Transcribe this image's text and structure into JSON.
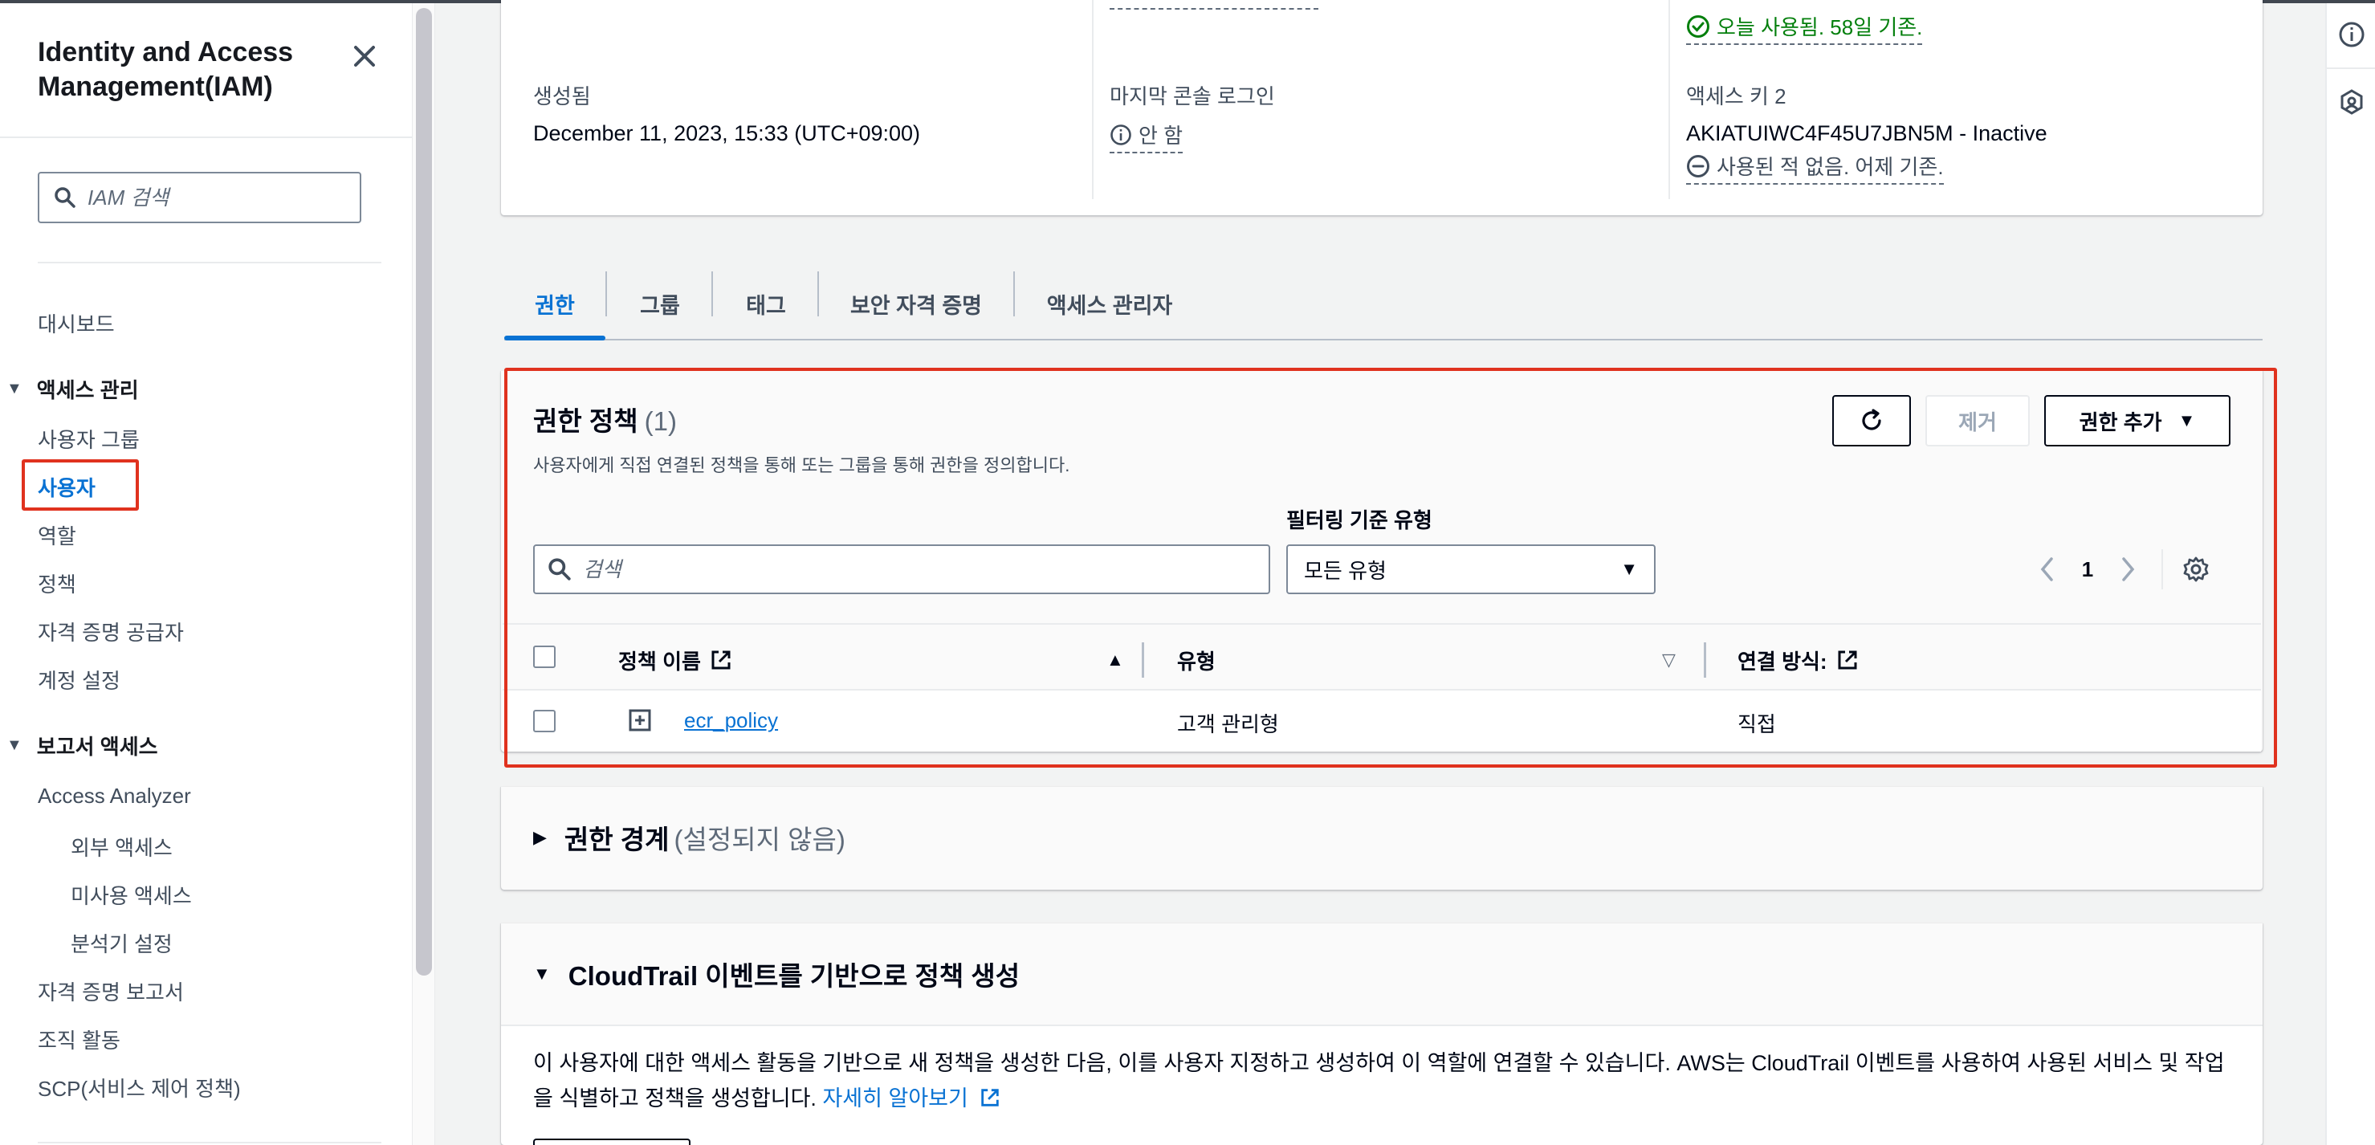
{
  "sidebar": {
    "title": "Identity and Access Management(IAM)",
    "search_placeholder": "IAM 검색",
    "dashboard": "대시보드",
    "access_mgmt": {
      "label": "액세스 관리",
      "items": [
        "사용자 그룹",
        "사용자",
        "역할",
        "정책",
        "자격 증명 공급자",
        "계정 설정"
      ],
      "active_item": "사용자"
    },
    "reports": {
      "label": "보고서 액세스",
      "analyzer": "Access Analyzer",
      "analyzer_sub": [
        "외부 액세스",
        "미사용 액세스",
        "분석기 설정"
      ],
      "items": [
        "자격 증명 보고서",
        "조직 활동",
        "SCP(서비스 제어 정책)"
      ]
    }
  },
  "summary": {
    "created_label": "생성됨",
    "created_value": "December 11, 2023, 15:33 (UTC+09:00)",
    "last_login_label": "마지막 콘솔 로그인",
    "last_login_value": "안 함",
    "key1_status": "오늘 사용됨. 58일 기존.",
    "key2_label": "액세스 키 2",
    "key2_value": "AKIATUIWC4F45U7JBN5M - Inactive",
    "key2_status": "사용된 적 없음. 어제 기존."
  },
  "tabs": [
    "권한",
    "그룹",
    "태그",
    "보안 자격 증명",
    "액세스 관리자"
  ],
  "permissions": {
    "title": "권한 정책",
    "count": "(1)",
    "description": "사용자에게 직접 연결된 정책을 통해 또는 그룹을 통해 권한을 정의합니다.",
    "remove_label": "제거",
    "add_label": "권한 추가",
    "filter_label": "필터링 기준 유형",
    "search_placeholder": "검색",
    "filter_value": "모든 유형",
    "page": "1",
    "columns": [
      "정책 이름",
      "유형",
      "연결 방식:"
    ],
    "rows": [
      {
        "name": "ecr_policy",
        "type": "고객 관리형",
        "attached": "직접"
      }
    ]
  },
  "boundary": {
    "title": "권한 경계",
    "subtitle": "(설정되지 않음)"
  },
  "cloudtrail": {
    "title": "CloudTrail 이벤트를 기반으로 정책 생성",
    "body": "이 사용자에 대한 액세스 활동을 기반으로 새 정책을 생성한 다음, 이를 사용자 지정하고 생성하여 이 역할에 연결할 수 있습니다. AWS는 CloudTrail 이벤트를 사용하여 사용된 서비스 및 작업을 식별하고 정책을 생성합니다.",
    "learn_more": "자세히 알아보기"
  },
  "colors": {
    "accent": "#0972d3",
    "highlight": "#e0321e",
    "success": "#037f0c"
  }
}
